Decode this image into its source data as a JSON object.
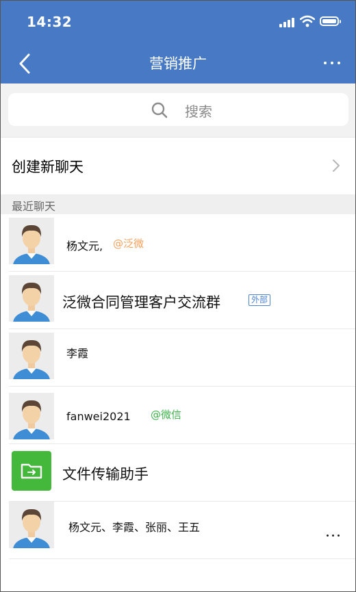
{
  "status_bar": {
    "time": "14:32"
  },
  "nav": {
    "title": "营销推广"
  },
  "search": {
    "placeholder": "搜索"
  },
  "create_chat": {
    "label": "创建新聊天"
  },
  "recent": {
    "section_label": "最近聊天"
  },
  "chats": [
    {
      "name": "杨文元,",
      "tag": "@泛微",
      "tag_color": "#f4a05a"
    },
    {
      "name": "泛微合同管理客户交流群",
      "badge": "外部"
    },
    {
      "name": "李霞"
    },
    {
      "name": "fanwei2021",
      "tag": "@微信",
      "tag_color": "#3db24a"
    },
    {
      "name": "文件传输助手",
      "icon": "file-transfer-icon"
    },
    {
      "name": "杨文元、李霞、张丽、王五",
      "more": "more-icon"
    }
  ],
  "colors": {
    "header": "#4879c4",
    "file_icon": "#44b83a",
    "external_badge": "#4b83d2"
  }
}
